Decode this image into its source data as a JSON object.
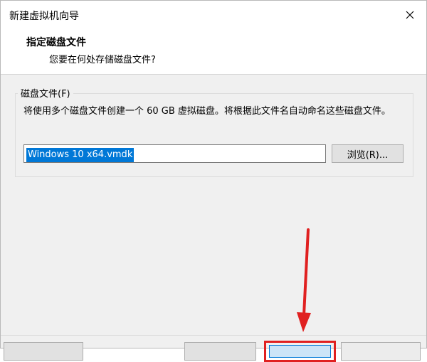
{
  "window": {
    "title": "新建虚拟机向导",
    "close_glyph": "✕"
  },
  "header": {
    "title": "指定磁盘文件",
    "subtitle": "您要在何处存储磁盘文件?"
  },
  "disk_file_group": {
    "legend": "磁盘文件(F)",
    "description": "将使用多个磁盘文件创建一个 60 GB 虚拟磁盘。将根据此文件名自动命名这些磁盘文件。",
    "filename_value": "Windows 10 x64.vmdk",
    "browse_label": "浏览(R)..."
  },
  "annotation": {
    "arrow_color": "#e02020",
    "highlight_color": "#e02020"
  },
  "colors": {
    "selection_bg": "#0078d7",
    "dialog_bg": "#f0f0f0"
  }
}
